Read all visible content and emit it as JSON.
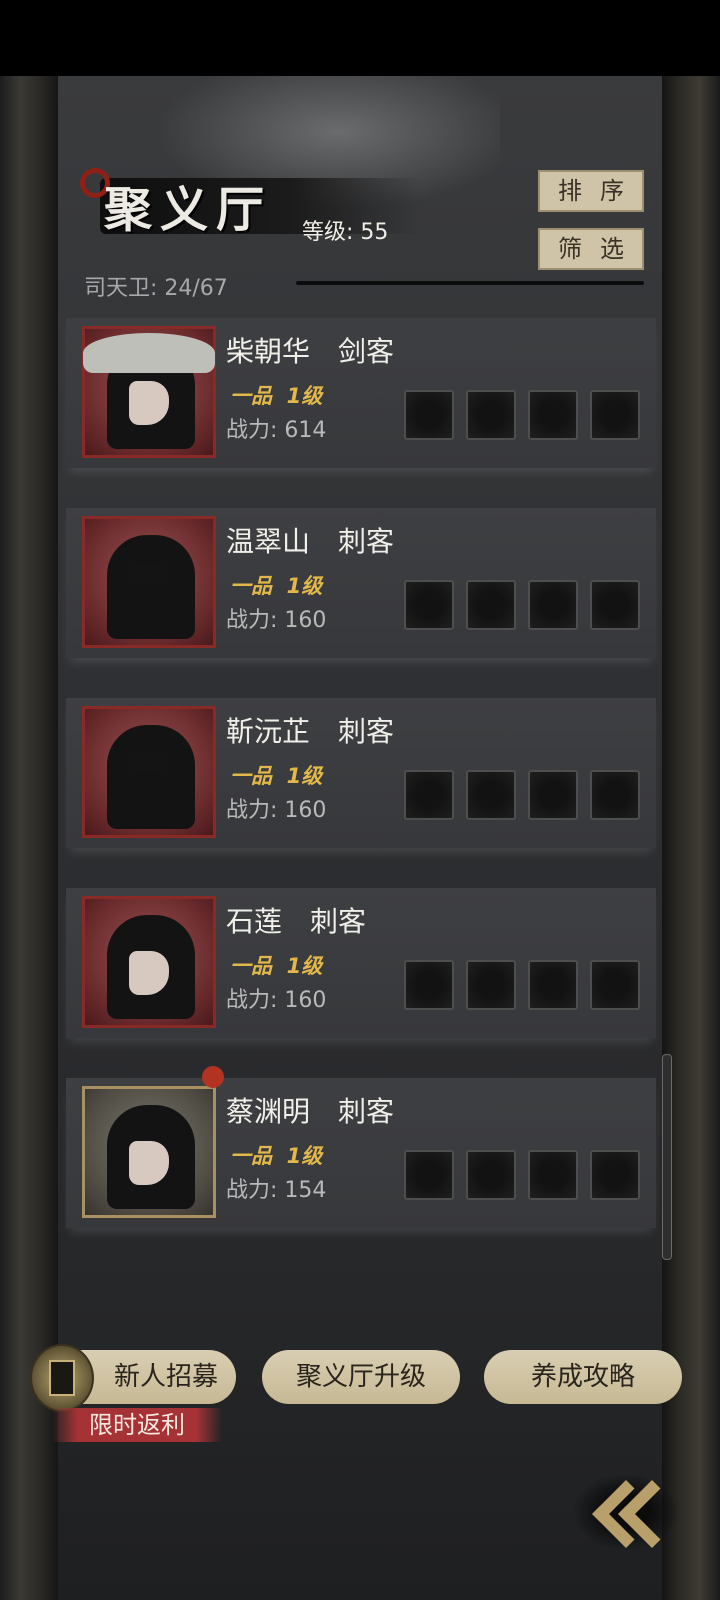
{
  "header": {
    "title": "聚义厅",
    "level_label": "等级: 55",
    "guards_label": "司天卫: 24/67",
    "sort_label": "排序",
    "filter_label": "筛选"
  },
  "heroes": [
    {
      "name": "柴朝华　剑客",
      "rank": "一品  1级",
      "power": "战力: 614",
      "has_notice": false
    },
    {
      "name": "温翠山　刺客",
      "rank": "一品  1级",
      "power": "战力: 160",
      "has_notice": false
    },
    {
      "name": "靳沅芷　刺客",
      "rank": "一品  1级",
      "power": "战力: 160",
      "has_notice": false
    },
    {
      "name": "石莲　刺客",
      "rank": "一品  1级",
      "power": "战力: 160",
      "has_notice": false
    },
    {
      "name": "蔡渊明　刺客",
      "rank": "一品  1级",
      "power": "战力: 154",
      "has_notice": true
    }
  ],
  "bottom": {
    "recruit_label": "新人招募",
    "limited_tag": "限时返利",
    "upgrade_label": "聚义厅升级",
    "guide_label": "养成攻略"
  },
  "colors": {
    "accent_gold": "#e3b84a",
    "button_beige": "#cfc4a8",
    "portrait_red": "#8a2a26",
    "notice_red": "#b23322"
  },
  "icons": {
    "back": "double-chevron-left-icon",
    "recruit": "recruit-token-icon"
  }
}
